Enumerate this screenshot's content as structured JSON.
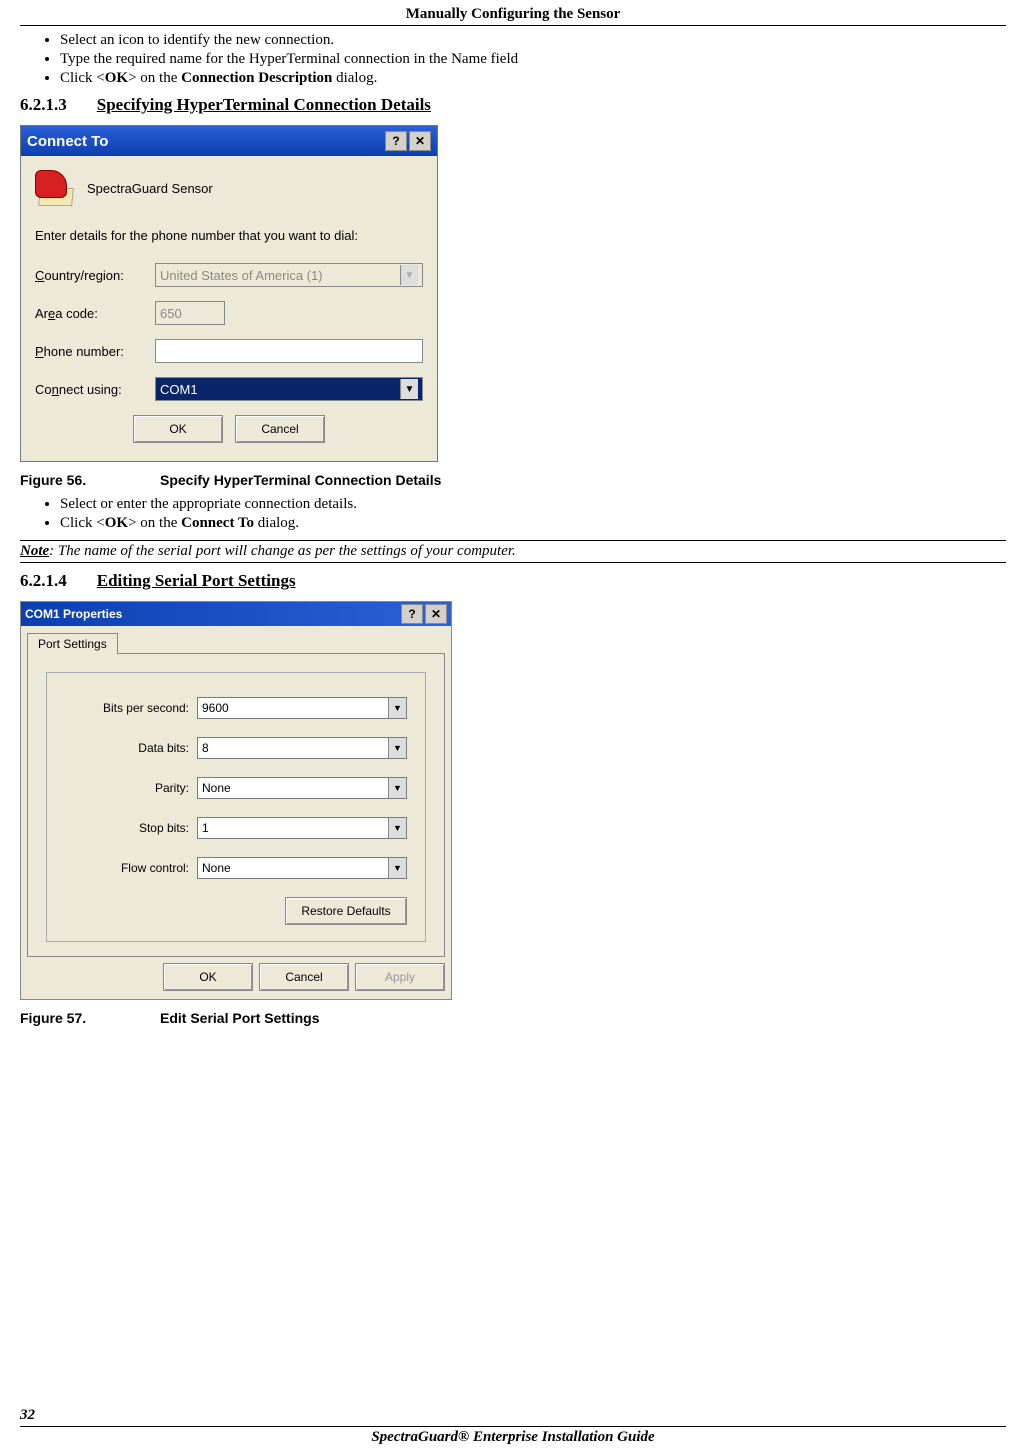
{
  "header": "Manually Configuring the Sensor",
  "top_list": {
    "i1": "Select an icon to identify the new connection.",
    "i2": "Type the required name for the HyperTerminal connection in the Name field",
    "i3_a": "Click <",
    "i3_ok": "OK",
    "i3_b": "> on the ",
    "i3_bold": "Connection Description",
    "i3_c": " dialog."
  },
  "section1": {
    "num": "6.2.1.3",
    "title": "Specifying HyperTerminal Connection Details"
  },
  "dialog1": {
    "title": "Connect To",
    "help_btn": "?",
    "close_btn": "✕",
    "app_name": "SpectraGuard Sensor",
    "prompt": "Enter details for the phone number that you want to dial:",
    "country_label_u": "C",
    "country_label": "ountry/region:",
    "country_value": "United States of America (1)",
    "area_label_a": "Ar",
    "area_label_u": "e",
    "area_label_b": "a code:",
    "area_value": "650",
    "phone_label_u": "P",
    "phone_label": "hone number:",
    "phone_value": "",
    "connect_label_a": "Co",
    "connect_label_u": "n",
    "connect_label_b": "nect using:",
    "connect_value": "COM1",
    "ok": "OK",
    "cancel": "Cancel"
  },
  "fig1": {
    "label": "Figure  56.",
    "title": "Specify HyperTerminal Connection Details"
  },
  "mid_list": {
    "i1": "Select or enter the appropriate connection details.",
    "i2_a": "Click <",
    "i2_ok": "OK",
    "i2_b": "> on the ",
    "i2_bold": "Connect To",
    "i2_c": " dialog."
  },
  "note": {
    "label": "Note",
    "text": ": The name of the serial port will change as per the settings of your computer."
  },
  "section2": {
    "num": "6.2.1.4",
    "title": "Editing Serial Port Settings"
  },
  "dialog2": {
    "title": "COM1 Properties",
    "help_btn": "?",
    "close_btn": "✕",
    "tab": "Port Settings",
    "bits_label": "Bits per second:",
    "bits_value": "9600",
    "data_label": "Data bits:",
    "data_value": "8",
    "parity_label": "Parity:",
    "parity_value": "None",
    "stop_label": "Stop bits:",
    "stop_value": "1",
    "flow_label": "Flow control:",
    "flow_value": "None",
    "restore": "Restore Defaults",
    "ok": "OK",
    "cancel": "Cancel",
    "apply": "Apply"
  },
  "fig2": {
    "label": "Figure  57.",
    "title": "Edit Serial Port Settings"
  },
  "footer": {
    "page": "32",
    "title": "SpectraGuard® Enterprise Installation Guide"
  }
}
